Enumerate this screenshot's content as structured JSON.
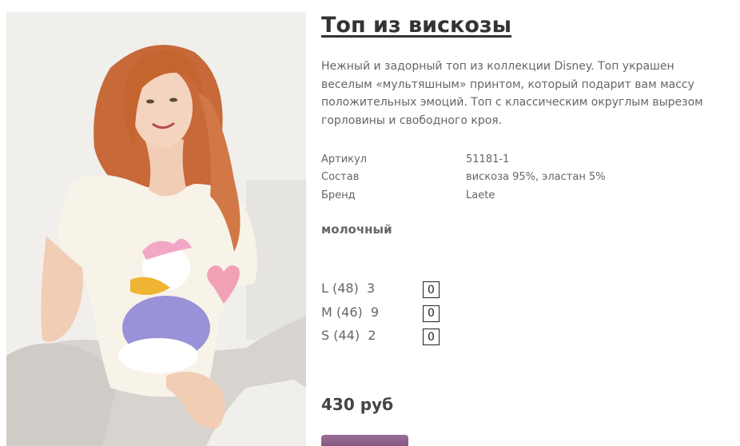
{
  "product": {
    "title": "Топ из вискозы",
    "description": "Нежный и задорный топ из коллекции Disney. Топ украшен веселым «мультяшным» принтом, который подарит вам массу положительных эмоций. Топ с классическим округлым вырезом горловины и свободного кроя.",
    "specs": [
      {
        "label": "Артикул",
        "value": "51181-1"
      },
      {
        "label": "Состав",
        "value": "вискоза 95%, эластан 5%"
      },
      {
        "label": "Бренд",
        "value": "Laete"
      }
    ],
    "color": "молочный",
    "sizes": [
      {
        "label": "L (48)  3",
        "quantity": "0"
      },
      {
        "label": "M (46)  9",
        "quantity": "0"
      },
      {
        "label": "S (44)  2",
        "quantity": "0"
      }
    ],
    "price": "430 руб"
  },
  "colors": {
    "title": "#333333",
    "text": "#666666",
    "button": "#8a5e88"
  }
}
